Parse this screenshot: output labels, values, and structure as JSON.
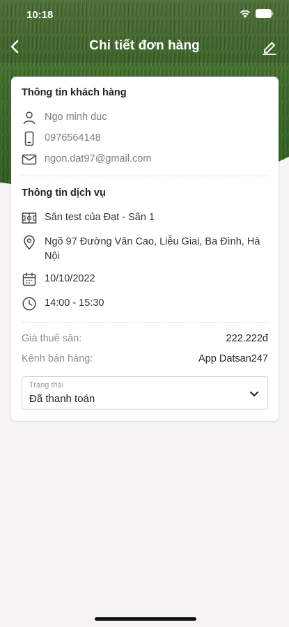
{
  "status_bar": {
    "time": "10:18"
  },
  "nav": {
    "title": "Chi tiết đơn hàng"
  },
  "customer": {
    "section_title": "Thông tin khách hàng",
    "name": "Ngo minh duc",
    "phone": "0976564148",
    "email": "ngon.dat97@gmail.com"
  },
  "service": {
    "section_title": "Thông tin dịch vụ",
    "field_name": "Sân test của Đạt - Sân 1",
    "address": "Ngõ 97 Đường Văn Cao, Liễu Giai, Ba Đình, Hà Nội",
    "date": "10/10/2022",
    "time": "14:00 - 15:30"
  },
  "summary": {
    "price_label": "Giá thuê sân:",
    "price_value": "222.222đ",
    "channel_label": "Kênh bán hàng:",
    "channel_value": "App Datsan247"
  },
  "status_select": {
    "label": "Trạng thái",
    "value": "Đã thanh toán"
  },
  "icons": [
    "back-icon",
    "edit-icon",
    "user-icon",
    "phone-icon",
    "mail-icon",
    "field-icon",
    "location-icon",
    "calendar-icon",
    "clock-icon",
    "chevron-down-icon",
    "wifi-icon",
    "battery-icon"
  ],
  "colors": {
    "page_bg": "#f5f4f3",
    "grass": "#3f6b2c",
    "card_bg": "#ffffff"
  }
}
